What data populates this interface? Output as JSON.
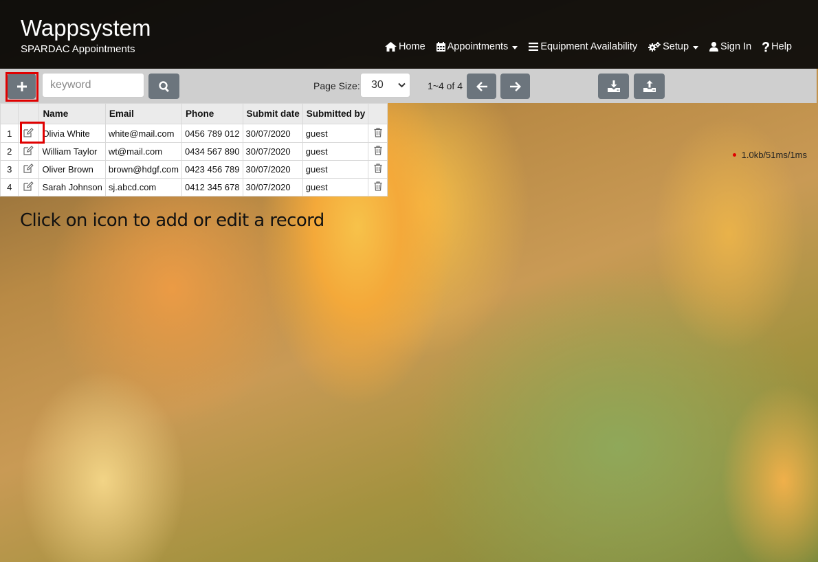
{
  "brand": {
    "title": "Wappsystem",
    "subtitle": "SPARDAC Appointments"
  },
  "nav": [
    {
      "label": "Home",
      "icon": "home-icon",
      "dropdown": false
    },
    {
      "label": "Appointments",
      "icon": "calendar-icon",
      "dropdown": true
    },
    {
      "label": "Equipment Availability",
      "icon": "list-icon",
      "dropdown": false
    },
    {
      "label": "Setup",
      "icon": "gears-icon",
      "dropdown": true
    },
    {
      "label": "Sign In",
      "icon": "user-icon",
      "dropdown": false
    },
    {
      "label": "Help",
      "icon": "question-icon",
      "dropdown": false
    }
  ],
  "toolbar": {
    "search_placeholder": "keyword",
    "page_size_label": "Page Size:",
    "page_size_value": "30",
    "range_text": "1~4 of 4",
    "stats": "1.0kb/51ms/1ms"
  },
  "table": {
    "columns": [
      "Name",
      "Email",
      "Phone",
      "Submit date",
      "Submitted by"
    ],
    "rows": [
      {
        "index": "1",
        "name": "Olivia White",
        "email": "white@mail.com",
        "phone": "0456 789 012",
        "date": "30/07/2020",
        "by": "guest"
      },
      {
        "index": "2",
        "name": "William Taylor",
        "email": "wt@mail.com",
        "phone": "0434 567 890",
        "date": "30/07/2020",
        "by": "guest"
      },
      {
        "index": "3",
        "name": "Oliver Brown",
        "email": "brown@hdgf.com",
        "phone": "0423 456 789",
        "date": "30/07/2020",
        "by": "guest"
      },
      {
        "index": "4",
        "name": "Sarah Johnson",
        "email": "sj.abcd.com",
        "phone": "0412 345 678",
        "date": "30/07/2020",
        "by": "guest"
      }
    ]
  },
  "hint": "Click on icon to add or edit a record",
  "colors": {
    "header_bg": "#0a0a0a",
    "toolbar_bg": "#cfcfcf",
    "button_bg": "#6c757d",
    "highlight": "#e00000"
  }
}
